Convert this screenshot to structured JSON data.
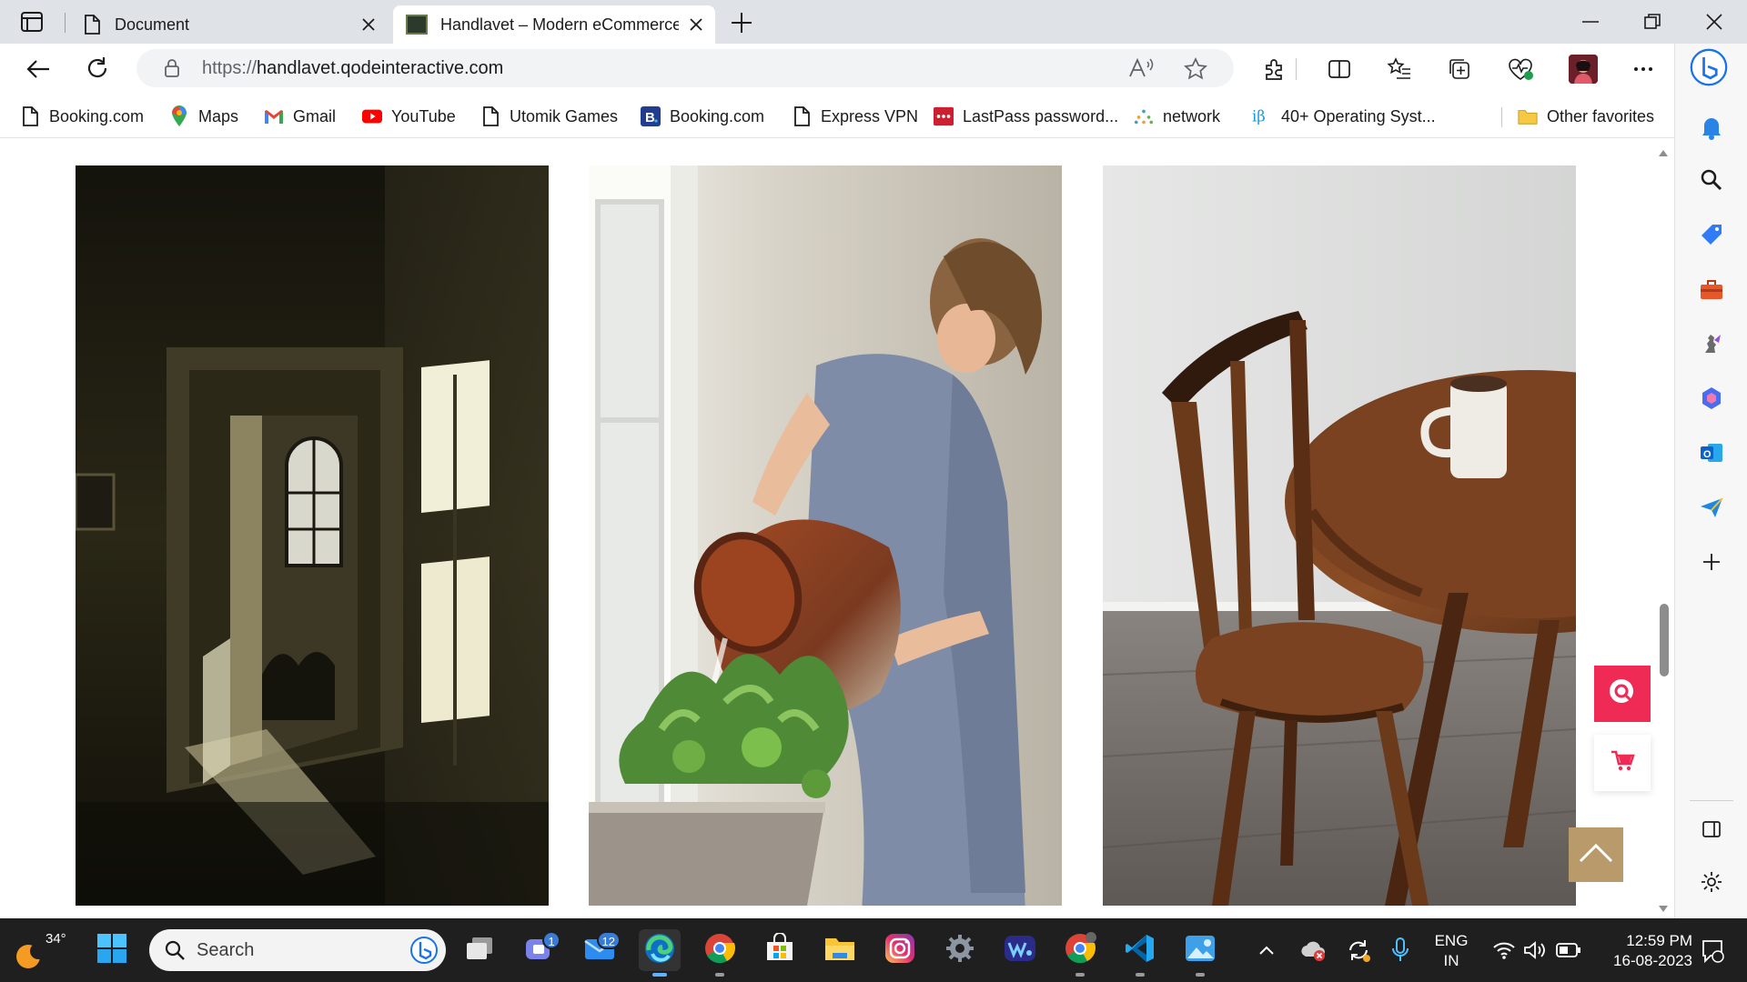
{
  "browser": {
    "tabs": [
      {
        "label": "Document"
      },
      {
        "label": "Handlavet – Modern eCommerce"
      }
    ],
    "url_prefix": "https://",
    "url_host": "handlavet.qodeinteractive.com",
    "favorites": [
      {
        "label": "Booking.com",
        "icon": "page-icon"
      },
      {
        "label": "Maps",
        "icon": "maps-pin-icon"
      },
      {
        "label": "Gmail",
        "icon": "gmail-icon"
      },
      {
        "label": "YouTube",
        "icon": "youtube-icon"
      },
      {
        "label": "Utomik Games",
        "icon": "page-icon"
      },
      {
        "label": "Booking.com",
        "icon": "booking-b-icon"
      },
      {
        "label": "Express VPN",
        "icon": "page-icon"
      },
      {
        "label": "LastPass password...",
        "icon": "lastpass-icon"
      },
      {
        "label": "network",
        "icon": "network-icon"
      },
      {
        "label": "40+ Operating Syst...",
        "icon": "ib-icon"
      },
      {
        "label": "Other favorites",
        "icon": "folder-icon"
      }
    ]
  },
  "page": {
    "photos": [
      {
        "subject": "sunlit doorway in a dark room"
      },
      {
        "subject": "woman watering plants from a clay vessel"
      },
      {
        "subject": "wooden chair beside a round table with a mug"
      }
    ]
  },
  "taskbar": {
    "weather_temp": "34°",
    "search_placeholder": "Search",
    "teams_badge": "1",
    "mail_badge": "12",
    "lang_line1": "ENG",
    "lang_line2": "IN",
    "time": "12:59 PM",
    "date": "16-08-2023"
  },
  "colors": {
    "accent_pink": "#ee2a55",
    "back_to_top": "#b99b6b",
    "taskbar_bg": "#1f1f1f",
    "tabstrip_bg": "#dfe3e8"
  }
}
